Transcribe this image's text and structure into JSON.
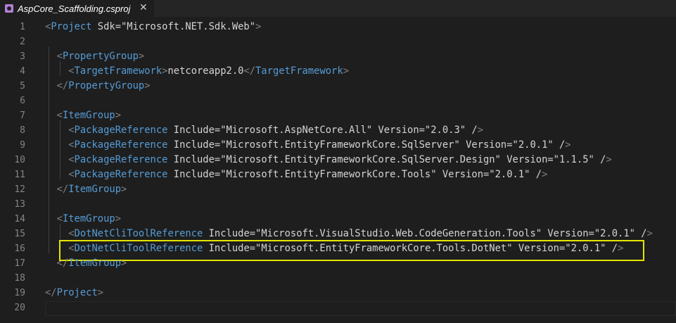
{
  "tab": {
    "title": "AspCore_Scaffolding.csproj",
    "icon": "gear-icon",
    "icon_color": "#b180d7"
  },
  "editor": {
    "colors": {
      "tag": "#569cd6",
      "attr": "#9cdcfe",
      "string": "#ce9178",
      "punct": "#808080",
      "text": "#d4d4d4",
      "line_number": "#858585",
      "highlight": "#e5e500"
    },
    "highlight_line": 16,
    "lines": [
      {
        "n": "1",
        "text": "<Project Sdk=\"Microsoft.NET.Sdk.Web\">"
      },
      {
        "n": "2",
        "text": ""
      },
      {
        "n": "3",
        "text": "  <PropertyGroup>"
      },
      {
        "n": "4",
        "text": "    <TargetFramework>netcoreapp2.0</TargetFramework>"
      },
      {
        "n": "5",
        "text": "  </PropertyGroup>"
      },
      {
        "n": "6",
        "text": ""
      },
      {
        "n": "7",
        "text": "  <ItemGroup>"
      },
      {
        "n": "8",
        "text": "    <PackageReference Include=\"Microsoft.AspNetCore.All\" Version=\"2.0.3\" />"
      },
      {
        "n": "9",
        "text": "    <PackageReference Include=\"Microsoft.EntityFrameworkCore.SqlServer\" Version=\"2.0.1\" />"
      },
      {
        "n": "10",
        "text": "    <PackageReference Include=\"Microsoft.EntityFrameworkCore.SqlServer.Design\" Version=\"1.1.5\" />"
      },
      {
        "n": "11",
        "text": "    <PackageReference Include=\"Microsoft.EntityFrameworkCore.Tools\" Version=\"2.0.1\" />"
      },
      {
        "n": "12",
        "text": "  </ItemGroup>"
      },
      {
        "n": "13",
        "text": ""
      },
      {
        "n": "14",
        "text": "  <ItemGroup>"
      },
      {
        "n": "15",
        "text": "    <DotNetCliToolReference Include=\"Microsoft.VisualStudio.Web.CodeGeneration.Tools\" Version=\"2.0.1\" />"
      },
      {
        "n": "16",
        "text": "    <DotNetCliToolReference Include=\"Microsoft.EntityFrameworkCore.Tools.DotNet\" Version=\"2.0.1\" />"
      },
      {
        "n": "17",
        "text": "  </ItemGroup>"
      },
      {
        "n": "18",
        "text": ""
      },
      {
        "n": "19",
        "text": "</Project>"
      },
      {
        "n": "20",
        "text": ""
      }
    ]
  }
}
